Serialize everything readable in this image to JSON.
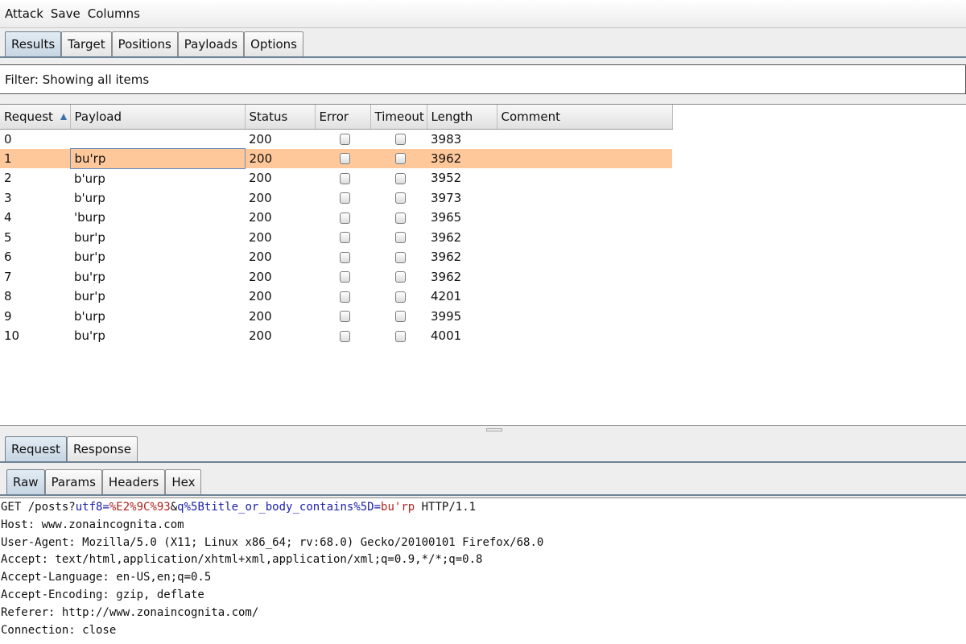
{
  "menu": [
    "Attack",
    "Save",
    "Columns"
  ],
  "tabs": [
    "Results",
    "Target",
    "Positions",
    "Payloads",
    "Options"
  ],
  "filter": "Filter: Showing all items",
  "columns": [
    "Request",
    "Payload",
    "Status",
    "Error",
    "Timeout",
    "Length",
    "Comment"
  ],
  "rows": [
    {
      "request": "0",
      "payload": "",
      "status": "200",
      "length": "3983"
    },
    {
      "request": "1",
      "payload": "bu'rp",
      "status": "200",
      "length": "3962"
    },
    {
      "request": "2",
      "payload": "b'urp",
      "status": "200",
      "length": "3952"
    },
    {
      "request": "3",
      "payload": "b'urp",
      "status": "200",
      "length": "3973"
    },
    {
      "request": "4",
      "payload": "'burp",
      "status": "200",
      "length": "3965"
    },
    {
      "request": "5",
      "payload": "bur'p",
      "status": "200",
      "length": "3962"
    },
    {
      "request": "6",
      "payload": "bur'p",
      "status": "200",
      "length": "3962"
    },
    {
      "request": "7",
      "payload": "bu'rp",
      "status": "200",
      "length": "3962"
    },
    {
      "request": "8",
      "payload": "bur'p",
      "status": "200",
      "length": "4201"
    },
    {
      "request": "9",
      "payload": "b'urp",
      "status": "200",
      "length": "3995"
    },
    {
      "request": "10",
      "payload": "bu'rp",
      "status": "200",
      "length": "4001"
    }
  ],
  "bottom_tabs": [
    "Request",
    "Response"
  ],
  "view_tabs": [
    "Raw",
    "Params",
    "Headers",
    "Hex"
  ],
  "request_line": {
    "method": "GET /posts?",
    "p1_name": "utf8",
    "eq1": "=",
    "p1_value": "%E2%9C%93",
    "amp": "&",
    "p2_name": "q%5Btitle_or_body_contains%5D",
    "eq2": "=",
    "p2_value": "bu'rp",
    "protocol": " HTTP/1.1"
  },
  "headers": [
    "Host: www.zonaincognita.com",
    "User-Agent: Mozilla/5.0 (X11; Linux x86_64; rv:68.0) Gecko/20100101 Firefox/68.0",
    "Accept: text/html,application/xhtml+xml,application/xml;q=0.9,*/*;q=0.8",
    "Accept-Language: en-US,en;q=0.5",
    "Accept-Encoding: gzip, deflate",
    "Referer: http://www.zonaincognita.com/",
    "Connection: close"
  ],
  "colors": {
    "selected_row": "#ffc89a",
    "param_name": "#1d21a8",
    "param_value": "#b3221d",
    "active_tab": "#c6d5e3"
  }
}
